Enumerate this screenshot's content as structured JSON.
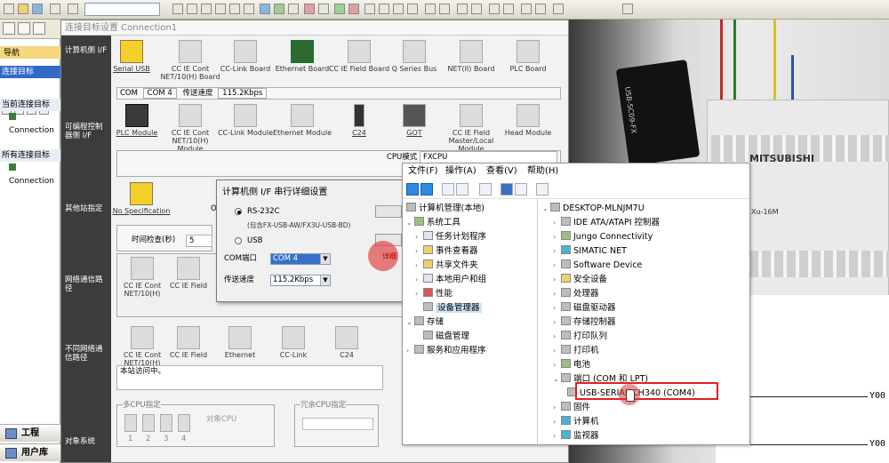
{
  "toolbar": {
    "buttons": [
      "new-icon",
      "open-icon",
      "save-icon",
      "print-icon",
      "cut-icon",
      "copy-icon",
      "paste-icon",
      "undo-icon",
      "redo-icon",
      "find-icon",
      "device-icon",
      "monitor-icon",
      "run-icon",
      "stop-icon",
      "ladder-icon",
      "zoom-icon"
    ],
    "select_value": ""
  },
  "nav": {
    "title": "导航",
    "connection_section": "连接目标",
    "current_target_label": "当前连接目标",
    "current_target_item": "Connection",
    "all_targets_label": "所有连接目标",
    "all_targets_item": "Connection",
    "bottom_project": "工程",
    "bottom_user": "用户库"
  },
  "conn": {
    "title": "连接目标设置 Connection1",
    "labels": {
      "pc_if": "计算机侧 I/F",
      "plc_if": "可编程控制器侧 I/F",
      "other_station": "其他站指定",
      "network_path": "网络通信路径",
      "diff_network": "不同网络通信路径",
      "target_system": "对象系统"
    },
    "pc_if_items": [
      "Serial USB",
      "CC IE Cont NET/10(H) Board",
      "CC-Link Board",
      "Ethernet Board",
      "CC IE Field Board",
      "Q Series Bus",
      "NET(II) Board",
      "PLC Board"
    ],
    "pc_if_status": {
      "com_label": "COM",
      "com_value": "COM 4",
      "speed_label": "传送速度",
      "speed_value": "115.2Kbps"
    },
    "plc_if_items": [
      "PLC Module",
      "CC IE Cont NET/10(H) Module",
      "CC-Link Module",
      "Ethernet Module",
      "C24",
      "GOT",
      "CC IE Field Master/Local Module",
      "Head Module"
    ],
    "cpu_mode_label": "CPU模式",
    "cpu_mode_value": "FXCPU",
    "other_station_item": "No Specification",
    "other_station_item2": "O",
    "time_check_label": "时间检查(秒)",
    "time_check_value": "5",
    "network_items": [
      "CC IE Cont NET/10(H)",
      "CC IE Field"
    ],
    "diff_network_items": [
      "CC IE Cont NET/10(H)",
      "CC IE Field",
      "Ethernet",
      "CC-Link",
      "C24"
    ],
    "access_note": "本站访问中。",
    "multi_cpu_label": "多CPU指定",
    "target_cpu_label": "对象CPU",
    "redundant_label": "冗余CPU指定",
    "cpu_numbers": [
      "1",
      "2",
      "3",
      "4"
    ]
  },
  "serial_dialog": {
    "title": "计算机侧 I/F 串行详细设置",
    "rs232c": "RS-232C",
    "rs232c_note": "(包含FX-USB-AW/FX3U-USB-BD)",
    "usb": "USB",
    "com_port_label": "COM端口",
    "com_port_value": "COM 4",
    "speed_label": "传送速度",
    "speed_value": "115.2Kbps",
    "detail_button": "详细"
  },
  "computer_mgmt": {
    "menu": [
      "文件(F)",
      "操作(A)",
      "查看(V)",
      "帮助(H)"
    ],
    "left_tree": [
      {
        "label": "计算机管理(本地)",
        "level": 0,
        "icon": "computer-icon"
      },
      {
        "label": "系统工具",
        "level": 1,
        "icon": "tools-icon",
        "expanded": true
      },
      {
        "label": "任务计划程序",
        "level": 2,
        "icon": "clock-icon"
      },
      {
        "label": "事件查看器",
        "level": 2,
        "icon": "event-icon"
      },
      {
        "label": "共享文件夹",
        "level": 2,
        "icon": "folder-icon"
      },
      {
        "label": "本地用户和组",
        "level": 2,
        "icon": "users-icon"
      },
      {
        "label": "性能",
        "level": 2,
        "icon": "performance-icon"
      },
      {
        "label": "设备管理器",
        "level": 2,
        "icon": "device-manager-icon",
        "selected": true
      },
      {
        "label": "存储",
        "level": 1,
        "icon": "storage-icon",
        "expanded": true
      },
      {
        "label": "磁盘管理",
        "level": 2,
        "icon": "disk-icon"
      },
      {
        "label": "服务和应用程序",
        "level": 1,
        "icon": "services-icon"
      }
    ],
    "right_tree": [
      {
        "label": "DESKTOP-MLNJM7U",
        "level": 0,
        "icon": "computer-icon"
      },
      {
        "label": "IDE ATA/ATAPI 控制器",
        "level": 1,
        "icon": "ide-icon"
      },
      {
        "label": "Jungo Connectivity",
        "level": 1,
        "icon": "jungo-icon"
      },
      {
        "label": "SIMATIC NET",
        "level": 1,
        "icon": "simatic-icon"
      },
      {
        "label": "Software Device",
        "level": 1,
        "icon": "software-icon"
      },
      {
        "label": "安全设备",
        "level": 1,
        "icon": "security-icon"
      },
      {
        "label": "处理器",
        "level": 1,
        "icon": "cpu-icon"
      },
      {
        "label": "磁盘驱动器",
        "level": 1,
        "icon": "disk-drive-icon"
      },
      {
        "label": "存储控制器",
        "level": 1,
        "icon": "storage-controller-icon"
      },
      {
        "label": "打印队列",
        "level": 1,
        "icon": "print-queue-icon"
      },
      {
        "label": "打印机",
        "level": 1,
        "icon": "printer-icon"
      },
      {
        "label": "电池",
        "level": 1,
        "icon": "battery-icon"
      },
      {
        "label": "端口 (COM 和 LPT)",
        "level": 1,
        "icon": "port-icon",
        "expanded": true
      },
      {
        "label": "USB-SERIAL CH340 (COM4)",
        "level": 2,
        "icon": "serial-port-icon",
        "highlighted": true
      },
      {
        "label": "固件",
        "level": 1,
        "icon": "firmware-icon"
      },
      {
        "label": "计算机",
        "level": 1,
        "icon": "computer-icon"
      },
      {
        "label": "监视器",
        "level": 1,
        "icon": "monitor-icon"
      }
    ]
  },
  "photo": {
    "brand": "MITSUBISHI",
    "model": "Xu-16M",
    "cable_label": "USB-SC09-FX"
  },
  "ladder": {
    "coil1": "Y00",
    "coil2": "Y00"
  }
}
